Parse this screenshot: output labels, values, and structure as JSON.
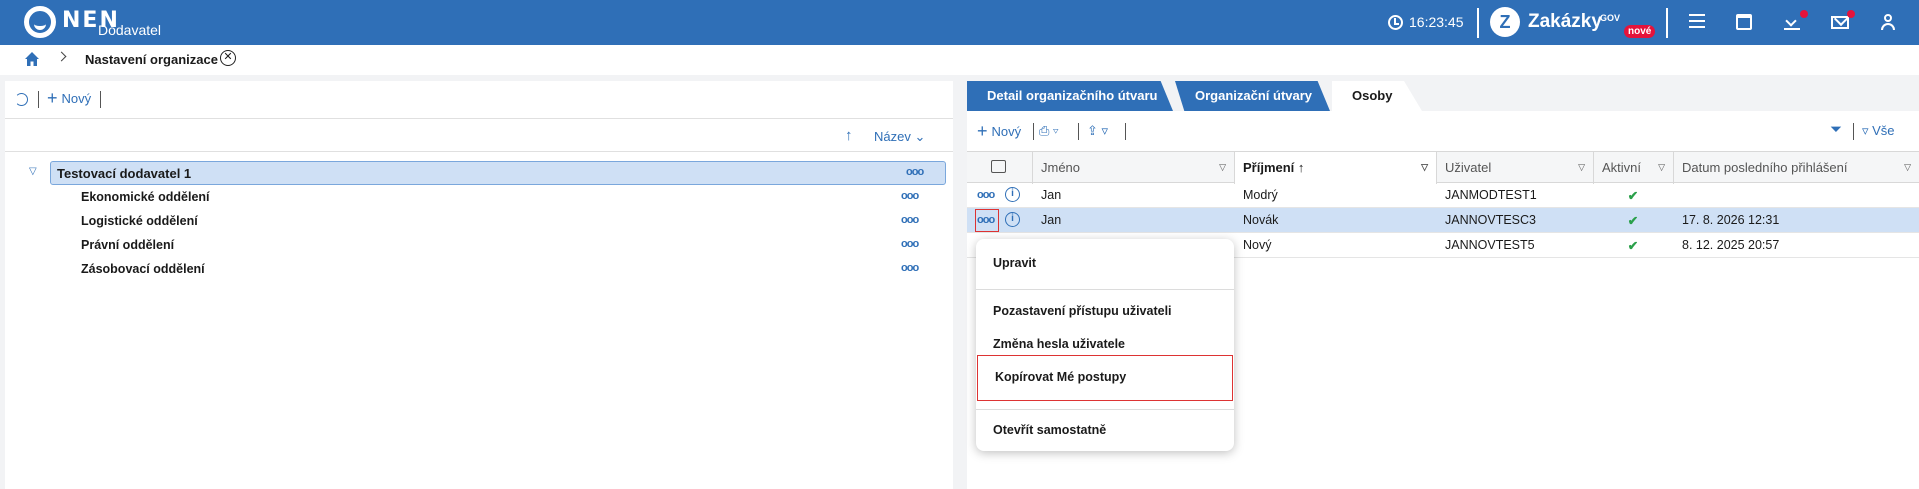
{
  "topbar": {
    "logo_text": "NEN",
    "logo_sub": "Dodavatel",
    "time": "16:23:45",
    "zakazky_label": "Zakázky",
    "zakazky_gov": "GOV",
    "zakazky_badge": "nové",
    "accent": "#2f6fb7",
    "icons": [
      "clock-icon",
      "menu-icon",
      "calendar-icon",
      "download-icon",
      "mail-icon",
      "user-icon"
    ]
  },
  "breadcrumb": {
    "title": "Nastavení organizace"
  },
  "left": {
    "new_label": "Nový",
    "sort_label": "Název",
    "root": "Testovací dodavatel 1",
    "children": [
      "Ekonomické oddělení",
      "Logistické oddělení",
      "Právní oddělení",
      "Zásobovací oddělení"
    ]
  },
  "right": {
    "tabs": [
      "Detail organizačního útvaru",
      "Organizační útvary",
      "Osoby"
    ],
    "active_tab": "Osoby",
    "new_label": "Nový",
    "filter_label": "Vše",
    "columns": [
      "Jméno",
      "Příjmení",
      "Uživatel",
      "Aktivní",
      "Datum posledního přihlášení"
    ],
    "rows": [
      {
        "jmeno": "Jan",
        "prijmeni": "Modrý",
        "uzivatel": "JANMODTEST1",
        "aktivni": "✔",
        "datum": ""
      },
      {
        "jmeno": "Jan",
        "prijmeni": "Novák",
        "uzivatel": "JANNOVTESC3",
        "aktivni": "✔",
        "datum": "17. 8. 2026 12:31"
      },
      {
        "jmeno": "",
        "prijmeni": "Nový",
        "uzivatel": "JANNOVTEST5",
        "aktivni": "✔",
        "datum": "8. 12. 2025 20:57"
      }
    ]
  },
  "context_menu": {
    "items": [
      "Upravit",
      "Pozastavení přístupu uživateli",
      "Změna hesla uživatele",
      "Kopírovat Mé postupy",
      "Otevřít samostatně"
    ]
  }
}
